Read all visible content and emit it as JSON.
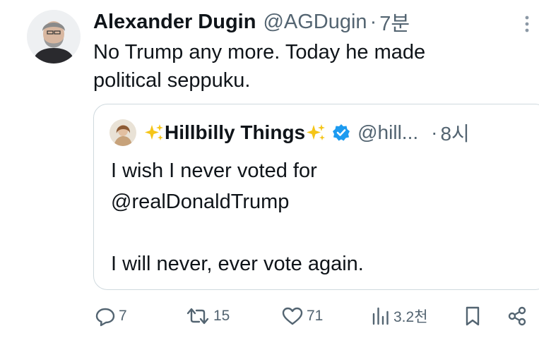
{
  "tweet": {
    "author_name": "Alexander Dugin",
    "author_handle": "@AGDugin",
    "separator": "·",
    "time": "7분",
    "text": "No Trump any more. Today he made\npolitical seppuku."
  },
  "quote": {
    "author_name": "Hillbilly Things",
    "author_handle": "@hill...",
    "separator": "·",
    "time": "8시",
    "text": "I wish I never voted for\n@realDonaldTrump\n\nI will never, ever vote again."
  },
  "actions": {
    "replies": "7",
    "retweets": "15",
    "likes": "71",
    "views": "3.2천"
  },
  "colors": {
    "text": "#0f1419",
    "muted": "#536471",
    "border": "#cfd9de",
    "verified": "#1d9bf0",
    "sparkle": "#f5c518"
  }
}
